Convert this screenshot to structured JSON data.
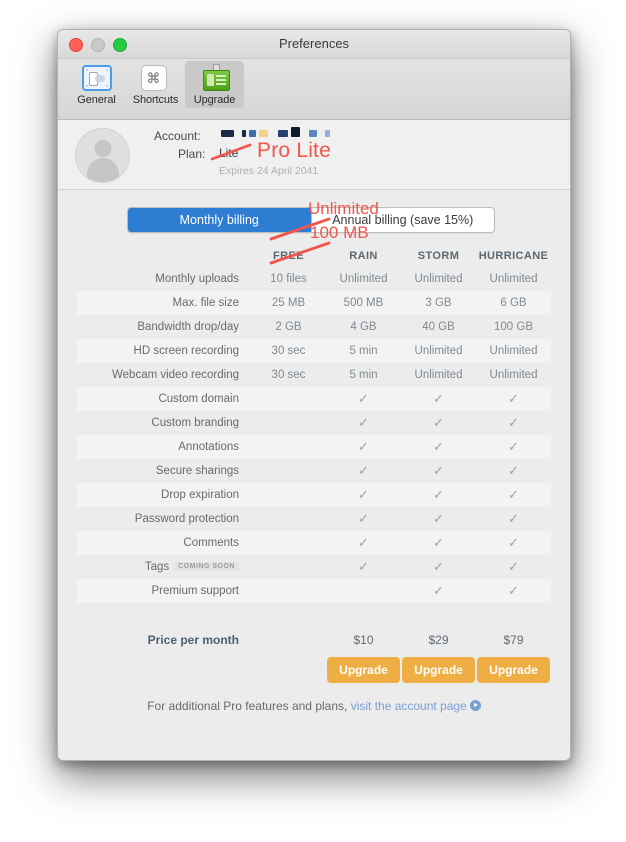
{
  "window": {
    "title": "Preferences",
    "traffic_lights": [
      "close",
      "minimize",
      "zoom"
    ]
  },
  "toolbar": {
    "items": [
      {
        "label": "General",
        "icon": "screen-recorder-icon",
        "selected": false
      },
      {
        "label": "Shortcuts",
        "icon": "command-key-icon",
        "selected": false
      },
      {
        "label": "Upgrade",
        "icon": "id-badge-icon",
        "selected": true
      }
    ]
  },
  "account": {
    "account_label": "Account:",
    "account_value_redacted": true,
    "plan_label": "Plan:",
    "plan_current": "Lite",
    "plan_annotation": "Pro Lite",
    "expires": "Expires 24 April 2041",
    "avatar": "default-user-avatar"
  },
  "billing": {
    "options": [
      {
        "label": "Monthly billing",
        "active": true
      },
      {
        "label": "Annual billing (save 15%)",
        "active": false
      }
    ]
  },
  "table": {
    "columns": [
      "FREE",
      "RAIN",
      "STORM",
      "HURRICANE"
    ],
    "rows": [
      {
        "label": "Monthly uploads",
        "values": [
          "10 files",
          "Unlimited",
          "Unlimited",
          "Unlimited"
        ]
      },
      {
        "label": "Max. file size",
        "values": [
          "25 MB",
          "500 MB",
          "3 GB",
          "6 GB"
        ]
      },
      {
        "label": "Bandwidth drop/day",
        "values": [
          "2 GB",
          "4 GB",
          "40 GB",
          "100 GB"
        ]
      },
      {
        "label": "HD screen recording",
        "values": [
          "30 sec",
          "5 min",
          "Unlimited",
          "Unlimited"
        ]
      },
      {
        "label": "Webcam video recording",
        "values": [
          "30 sec",
          "5 min",
          "Unlimited",
          "Unlimited"
        ]
      },
      {
        "label": "Custom domain",
        "values": [
          "",
          "check",
          "check",
          "check"
        ]
      },
      {
        "label": "Custom branding",
        "values": [
          "",
          "check",
          "check",
          "check"
        ]
      },
      {
        "label": "Annotations",
        "values": [
          "",
          "check",
          "check",
          "check"
        ]
      },
      {
        "label": "Secure sharings",
        "values": [
          "",
          "check",
          "check",
          "check"
        ]
      },
      {
        "label": "Drop expiration",
        "values": [
          "",
          "check",
          "check",
          "check"
        ]
      },
      {
        "label": "Password protection",
        "values": [
          "",
          "check",
          "check",
          "check"
        ]
      },
      {
        "label": "Comments",
        "values": [
          "",
          "check",
          "check",
          "check"
        ]
      },
      {
        "label": "Tags",
        "badge": "COMING SOON",
        "values": [
          "",
          "check",
          "check",
          "check"
        ]
      },
      {
        "label": "Premium support",
        "values": [
          "",
          "",
          "check",
          "check"
        ]
      }
    ],
    "price_row": {
      "label": "Price per month",
      "values": [
        "",
        "$10",
        "$29",
        "$79"
      ]
    },
    "upgrade_buttons": [
      "Upgrade",
      "Upgrade",
      "Upgrade"
    ]
  },
  "footer": {
    "text": "For additional Pro features and plans, ",
    "link": "visit the account page",
    "link_icon": "arrow-right-circle-icon"
  },
  "annotations": [
    {
      "text": "Unlimited",
      "target": "free-monthly-uploads"
    },
    {
      "text": "100 MB",
      "target": "free-max-file-size"
    },
    {
      "text": "Pro Lite",
      "target": "plan-value"
    }
  ],
  "colors": {
    "annotation_red": "#f2564a",
    "segment_active": "#2d7dd2",
    "upgrade_button": "#efae43",
    "check_mark": "#8fa4b5",
    "link": "#7c9fd4"
  }
}
